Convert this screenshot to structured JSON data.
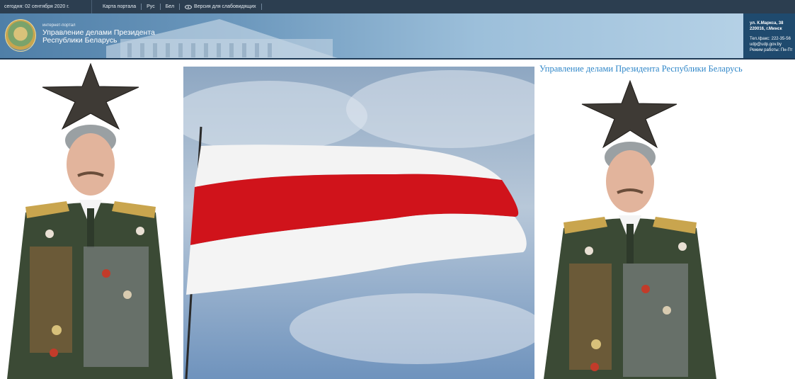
{
  "topbar": {
    "date": "сегодня: 02 сентября 2020 г.",
    "links": [
      "Карта портала",
      "Рус",
      "Бел"
    ],
    "vision_label": "Версия для слабовидящих"
  },
  "header": {
    "portal_label": "интернет-портал",
    "org_name_line1": "Управление делами Президента",
    "org_name_line2": "Республики Беларусь"
  },
  "contact": {
    "address_line1": "ул. К.Маркса, 38",
    "address_line2": "220016, г.Минск",
    "phone": "Тел./факс: 222-35-56",
    "email": "udp@udp.gov.by",
    "hours": "Режим работы: Пн-Пт"
  },
  "main": {
    "site_title": "Управление делами Президента Республики Беларусь"
  },
  "colors": {
    "topbar_bg": "#2c3e50",
    "banner_blue": "#6c98bd",
    "title_link": "#2e86c8",
    "flag_red": "#d0131b",
    "flag_white": "#f4f4f4"
  },
  "icons": [
    "eye-icon",
    "coat-of-arms-icon",
    "star-icon"
  ]
}
